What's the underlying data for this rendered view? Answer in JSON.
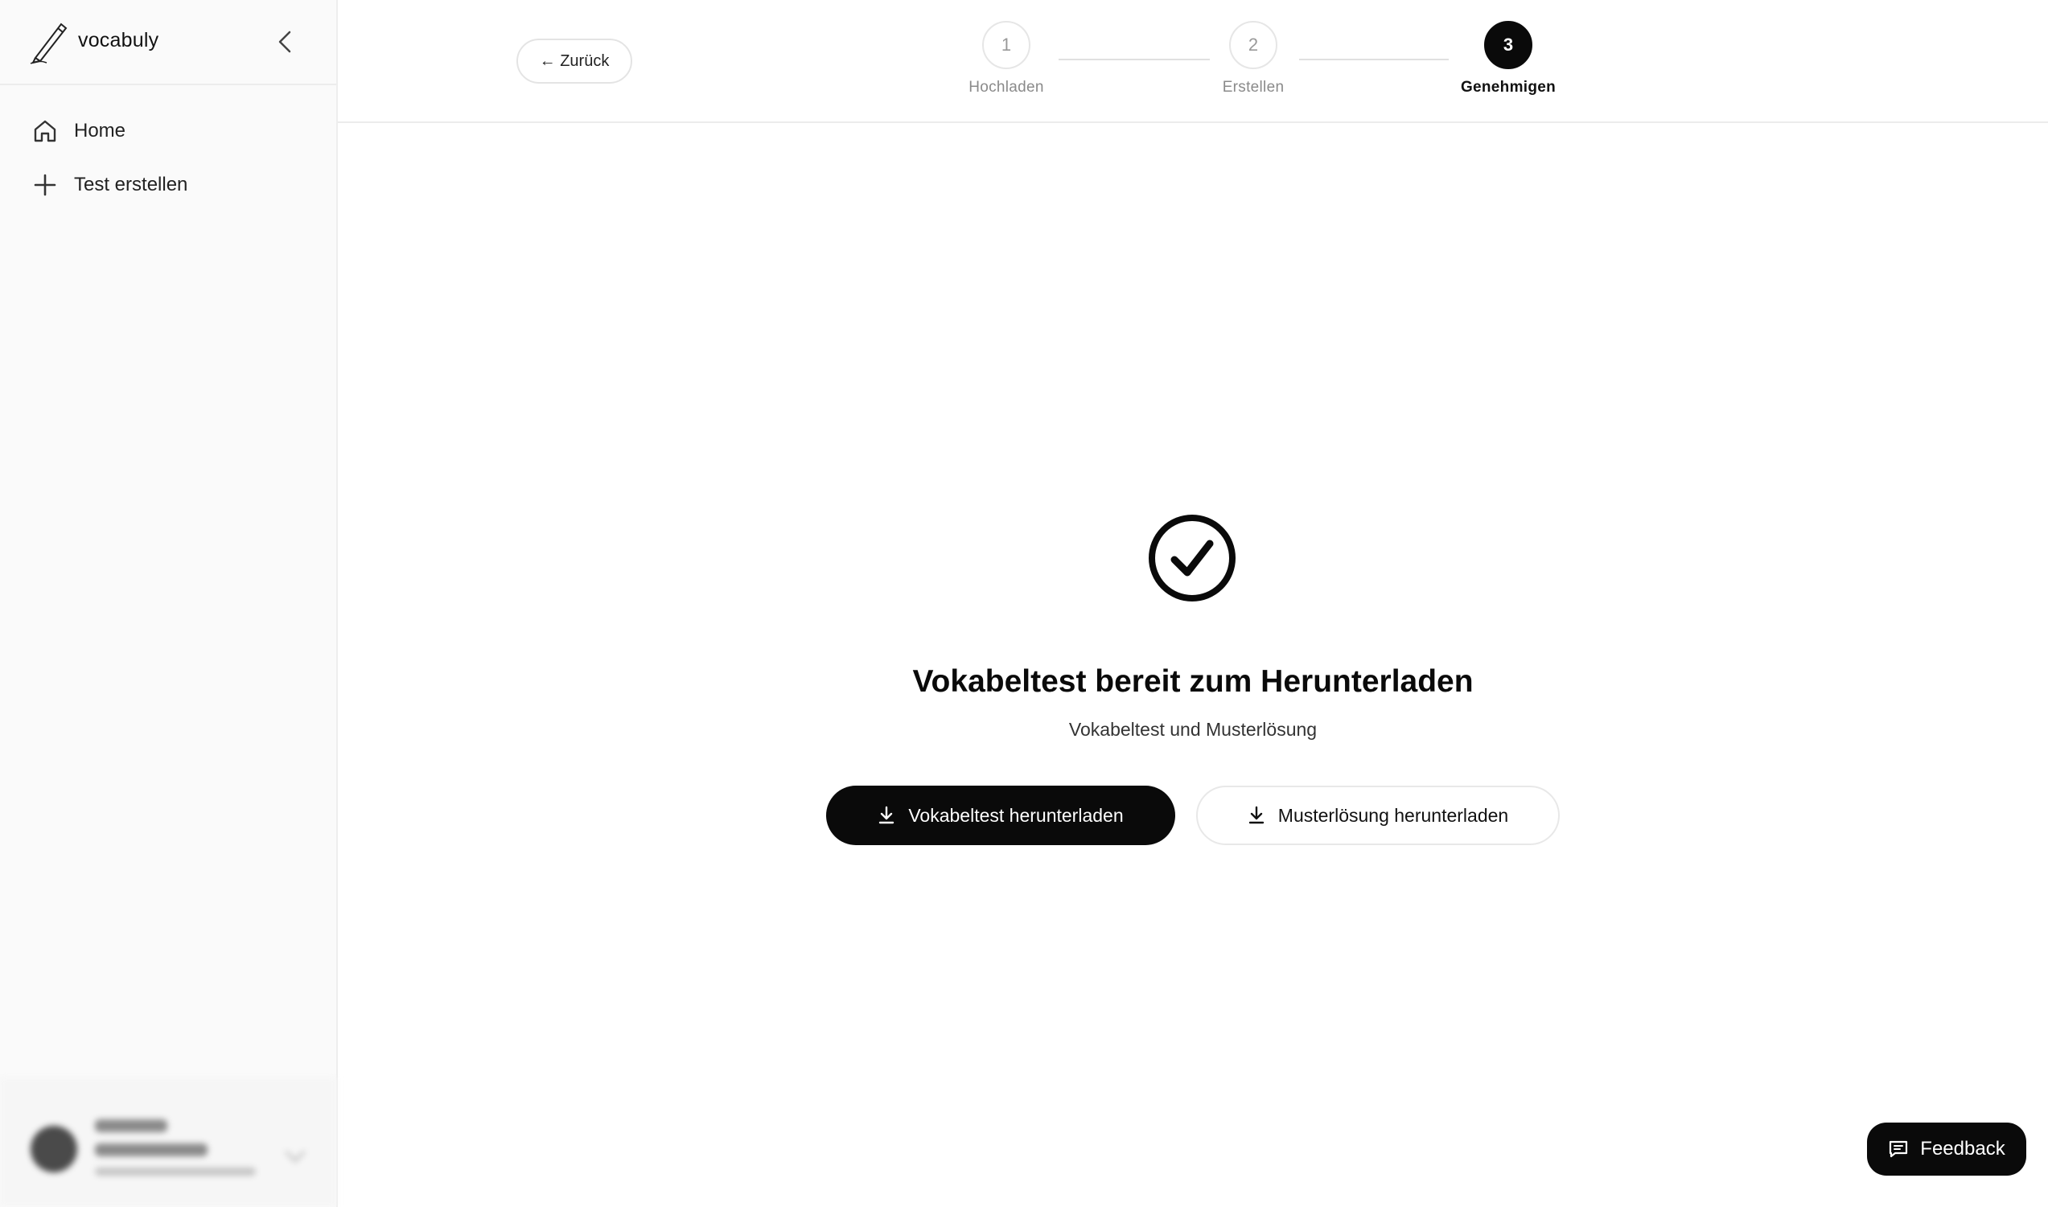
{
  "app": {
    "name": "vocabuly"
  },
  "sidebar": {
    "items": [
      {
        "label": "Home",
        "icon": "home-icon"
      },
      {
        "label": "Test erstellen",
        "icon": "plus-icon"
      }
    ],
    "collapse_icon": "chevron-left-icon"
  },
  "header": {
    "back_label": "← Zurück",
    "steps": [
      {
        "number": "1",
        "label": "Hochladen",
        "active": false
      },
      {
        "number": "2",
        "label": "Erstellen",
        "active": false
      },
      {
        "number": "3",
        "label": "Genehmigen",
        "active": true
      }
    ]
  },
  "main": {
    "status_icon": "check-circle-icon",
    "title": "Vokabeltest bereit zum Herunterladen",
    "subtitle": "Vokabeltest und Musterlösung",
    "primary_button": "Vokabeltest herunterladen",
    "secondary_button": "Musterlösung herunterladen"
  },
  "feedback": {
    "label": "Feedback"
  },
  "colors": {
    "accent": "#0a0a0a",
    "sidebar_bg": "#fafafa",
    "border": "#ececec",
    "muted_text": "#8a8a8a"
  }
}
